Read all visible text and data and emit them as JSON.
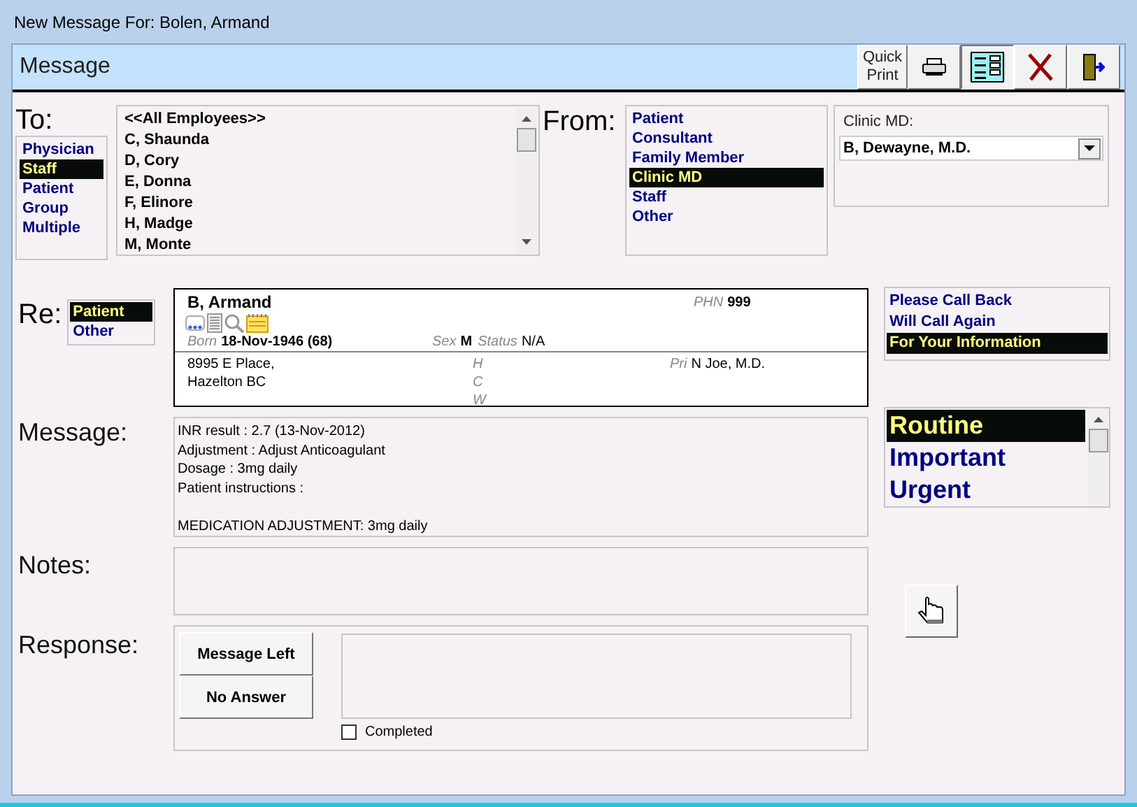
{
  "window": {
    "title": "New Message For:  Bolen, Armand"
  },
  "header": {
    "title": "Message"
  },
  "toolbar": [
    {
      "kind": "text",
      "label": "Quick Print",
      "selected": false
    },
    {
      "kind": "printer",
      "selected": false
    },
    {
      "kind": "form",
      "selected": true
    },
    {
      "kind": "delete",
      "selected": false
    },
    {
      "kind": "exit",
      "selected": false
    }
  ],
  "to": {
    "label": "To:",
    "categories": [
      {
        "label": "Physician",
        "selected": false
      },
      {
        "label": "Staff",
        "selected": true
      },
      {
        "label": "Patient",
        "selected": false
      },
      {
        "label": "Group",
        "selected": false
      },
      {
        "label": "Multiple",
        "selected": false
      }
    ],
    "recipients": [
      {
        "label": "<<All Employees>>",
        "selected": false
      },
      {
        "label": "C, Shaunda",
        "selected": false
      },
      {
        "label": "D, Cory",
        "selected": false
      },
      {
        "label": "E, Donna",
        "selected": false
      },
      {
        "label": "F, Elinore",
        "selected": false
      },
      {
        "label": "H, Madge",
        "selected": false
      },
      {
        "label": "M, Monte",
        "selected": false
      }
    ]
  },
  "from": {
    "label": "From:",
    "sources": [
      {
        "label": "Patient",
        "selected": false
      },
      {
        "label": "Consultant",
        "selected": false
      },
      {
        "label": "Family Member",
        "selected": false
      },
      {
        "label": "Clinic MD",
        "selected": true
      },
      {
        "label": "Staff",
        "selected": false
      },
      {
        "label": "Other",
        "selected": false
      }
    ],
    "clinic_md": {
      "label": "Clinic MD:",
      "value": "B, Dewayne, M.D."
    }
  },
  "re": {
    "label": "Re:",
    "options": [
      {
        "label": "Patient",
        "selected": true
      },
      {
        "label": "Other",
        "selected": false
      }
    ]
  },
  "patient": {
    "name": "B, Armand",
    "phn_label": "PHN",
    "phn": "999",
    "born_label": "Born",
    "born": "18-Nov-1946 (68)",
    "sex_label": "Sex",
    "sex": "M",
    "status_label": "Status",
    "status": "N/A",
    "address": [
      "8995 E Place,",
      "Hazelton BC"
    ],
    "phone_labels": [
      "H",
      "C",
      "W"
    ],
    "pri_label": "Pri",
    "pri": "N Joe, M.D."
  },
  "message_types": [
    {
      "label": "Please Call Back",
      "selected": false
    },
    {
      "label": "Will Call Again",
      "selected": false
    },
    {
      "label": "For Your Information",
      "selected": true
    }
  ],
  "priorities": [
    {
      "label": "Routine",
      "selected": true
    },
    {
      "label": "Important",
      "selected": false
    },
    {
      "label": "Urgent",
      "selected": false
    }
  ],
  "message": {
    "label": "Message:",
    "paragraphs": [
      [
        "INR result : 2.7 (13-Nov-2012)",
        "Adjustment : Adjust Anticoagulant",
        "Dosage : 3mg daily",
        "Patient instructions :"
      ],
      [
        "MEDICATION ADJUSTMENT: 3mg daily"
      ]
    ]
  },
  "notes": {
    "label": "Notes:"
  },
  "response": {
    "label": "Response:",
    "buttons": [
      "Message Left",
      "No Answer"
    ],
    "completed": {
      "label": "Completed",
      "checked": false
    }
  }
}
